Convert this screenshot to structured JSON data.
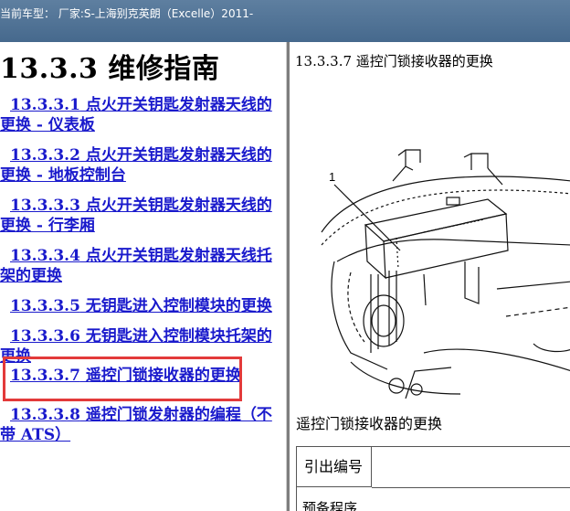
{
  "header": {
    "breadcrumb": "当前车型：  厂家:S-上海别克英朗（Excelle）2011-"
  },
  "left": {
    "title": "13.3.3 维修指南",
    "links": [
      {
        "num": "13.3.3.1",
        "line1": " 点火开关钥匙发射器天线的",
        "line2": "更换 - 仪表板"
      },
      {
        "num": "13.3.3.2",
        "line1": " 点火开关钥匙发射器天线的",
        "line2": "更换 - 地板控制台"
      },
      {
        "num": "13.3.3.3",
        "line1": " 点火开关钥匙发射器天线的",
        "line2": "更换 - 行李厢"
      },
      {
        "num": "13.3.3.4",
        "line1": " 点火开关钥匙发射器天线托",
        "line2": "架的更换"
      },
      {
        "num": "13.3.3.5",
        "line1": " 无钥匙进入控制模块的更换",
        "line2": ""
      },
      {
        "num": "13.3.3.6",
        "line1": " 无钥匙进入控制模块托架的",
        "line2": "更换"
      },
      {
        "num": "13.3.3.7",
        "line1": " 遥控门锁接收器的更换",
        "line2": ""
      },
      {
        "num": "13.3.3.8",
        "line1": " 遥控门锁发射器的编程（不",
        "line2": "带 ATS）"
      }
    ]
  },
  "right": {
    "heading": "13.3.3.7 遥控门锁接收器的更换",
    "figure_callout": "1",
    "caption": "遥控门锁接收器的更换",
    "table": {
      "header": "引出编号",
      "row2": "预备程序"
    }
  }
}
